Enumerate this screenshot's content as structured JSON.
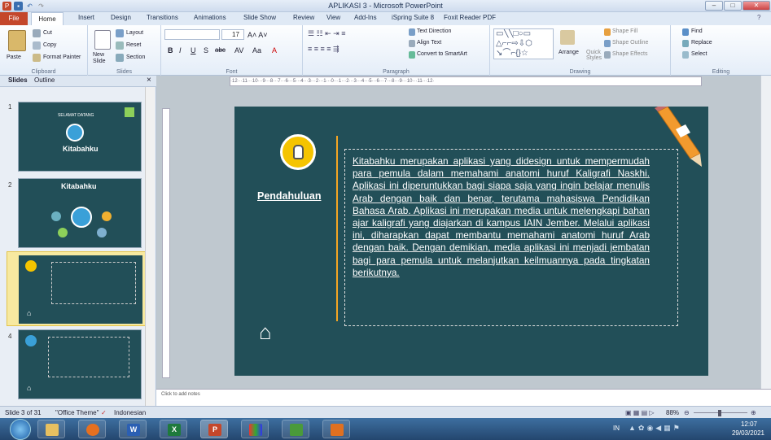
{
  "window": {
    "title": "APLIKASI 3 - Microsoft PowerPoint"
  },
  "tabs": [
    "Home",
    "Insert",
    "Design",
    "Transitions",
    "Animations",
    "Slide Show",
    "Review",
    "View",
    "Add-Ins",
    "iSpring Suite 8",
    "Foxit Reader PDF"
  ],
  "file_tab": "File",
  "ribbon": {
    "clipboard": {
      "label": "Clipboard",
      "paste": "Paste",
      "cut": "Cut",
      "copy": "Copy",
      "format_painter": "Format Painter"
    },
    "slides": {
      "label": "Slides",
      "new_slide": "New Slide",
      "layout": "Layout",
      "reset": "Reset",
      "section": "Section"
    },
    "font": {
      "label": "Font",
      "size": "17"
    },
    "paragraph": {
      "label": "Paragraph",
      "text_direction": "Text Direction",
      "align_text": "Align Text",
      "convert_smartart": "Convert to SmartArt"
    },
    "drawing": {
      "label": "Drawing",
      "arrange": "Arrange",
      "quick_styles": "Quick Styles",
      "shape_fill": "Shape Fill",
      "shape_outline": "Shape Outline",
      "shape_effects": "Shape Effects"
    },
    "editing": {
      "label": "Editing",
      "find": "Find",
      "replace": "Replace",
      "select": "Select"
    }
  },
  "pane": {
    "tab_slides": "Slides",
    "tab_outline": "Outline",
    "close": "×",
    "thumbs": [
      {
        "num": "1",
        "title": "Kitabahku",
        "subtitle": "SELAMAT DATANG"
      },
      {
        "num": "2",
        "title": "Kitabahku"
      },
      {
        "num": "3"
      },
      {
        "num": "4"
      }
    ]
  },
  "ruler": {
    "marks": "·12···11···10···9···8···7···6···5···4···3···2···1···0···1···2···3···4···5···6···7···8···9···10···11···12·"
  },
  "slide": {
    "heading": "Pendahuluan",
    "body": "Kitabahku merupakan aplikasi yang didesign untuk mempermudah para pemula dalam memahami anatomi huruf Kaligrafi Naskhi. Aplikasi ini diperuntukkan bagi siapa saja yang ingin belajar menulis Arab dengan baik dan benar, terutama mahasiswa Pendidikan Bahasa Arab. Aplikasi ini merupakan media untuk melengkapi bahan ajar kaligrafi yang diajarkan di kampus IAIN Jember. Melalui aplikasi ini, diharapkan dapat membantu memahami anatomi huruf Arab dengan baik. Dengan demikian, media aplikasi ini menjadi jembatan bagi para pemula untuk melanjutkan keilmuannya pada tingkatan berikutnya."
  },
  "notes": {
    "placeholder": "Click to add notes"
  },
  "status": {
    "slide": "Slide 3 of 31",
    "theme": "\"Office Theme\"",
    "language": "Indonesian",
    "zoom": "88%"
  },
  "taskbar": {
    "lang": "IN",
    "time": "12:07",
    "date": "29/03/2021"
  },
  "colors": {
    "slide_bg": "#224f58",
    "accent": "#f5c400",
    "file_tab": "#c4472b"
  }
}
